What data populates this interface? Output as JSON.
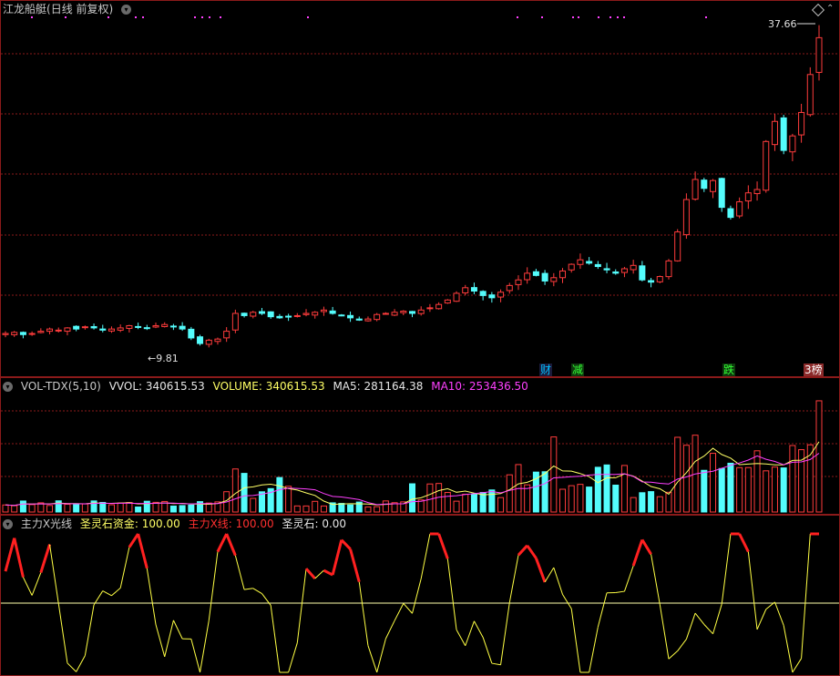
{
  "title": {
    "stock_name": "江龙船艇",
    "period": "(日线 前复权)",
    "menu_icon": "chevron-down-circle-icon"
  },
  "price": {
    "high_label": "37.66",
    "low_label": "9.81",
    "top_right_icon": "diamond-icon"
  },
  "event_tags": [
    {
      "text": "财",
      "color": "#00bfff",
      "bg": "#1a1a3a"
    },
    {
      "text": "减",
      "color": "#33ff33",
      "bg": "#0e3a0e"
    },
    {
      "text": "跌",
      "color": "#33ff33",
      "bg": "#0e3a0e"
    },
    {
      "text": "榜",
      "color": "#ffffff",
      "bg": "#8b2a2a",
      "prefix": "3"
    }
  ],
  "volume": {
    "name": "VOL-TDX(5,10)",
    "vvol": "VVOL: 340615.53",
    "volume": "VOLUME: 340615.53",
    "ma5": "MA5: 281164.38",
    "ma10": "MA10: 253436.50"
  },
  "indicator": {
    "name": "主力X光线",
    "fund": "圣灵石资金: 100.00",
    "xline": "主力X线: 100.00",
    "stone": "圣灵石: 0.00"
  },
  "colors": {
    "up": "#ff3c3c",
    "down": "#54fcfc",
    "ma5": "#ffff66",
    "ma10": "#ff40ff",
    "grid": "#8b1a1a",
    "ind_line": "#ffff44",
    "ind_strong": "#ff2020"
  },
  "chart_data": [
    {
      "type": "candlestick",
      "title": "江龙船艇(日线 前复权)",
      "annotations": [
        "37.66",
        "9.81"
      ],
      "approx_close": [
        10.8,
        10.9,
        10.7,
        10.8,
        11.0,
        11.2,
        11.1,
        11.3,
        11.2,
        11.4,
        11.3,
        11.1,
        11.2,
        11.3,
        11.5,
        11.4,
        11.3,
        11.5,
        11.6,
        11.4,
        11.2,
        10.4,
        9.9,
        10.2,
        10.3,
        11.0,
        12.6,
        12.4,
        12.7,
        12.6,
        12.3,
        12.2,
        12.3,
        12.4,
        12.6,
        12.7,
        12.9,
        12.6,
        12.4,
        12.2,
        12.0,
        12.1,
        12.5,
        12.6,
        12.7,
        12.8,
        12.6,
        12.9,
        13.1,
        13.4,
        13.8,
        14.4,
        14.9,
        14.6,
        14.2,
        14.0,
        14.5,
        15.1,
        15.6,
        16.2,
        16.0,
        15.5,
        15.8,
        16.4,
        17.0,
        17.4,
        17.1,
        16.8,
        16.5,
        16.2,
        16.6,
        16.9,
        15.6,
        15.4,
        15.9,
        17.3,
        19.9,
        22.8,
        24.6,
        23.8,
        24.5,
        22.1,
        21.2,
        22.6,
        23.4,
        23.7,
        28.0,
        29.8,
        27.2,
        28.5,
        30.6,
        34.0,
        37.3
      ]
    },
    {
      "type": "bar",
      "title": "VOL-TDX(5,10)",
      "series": [
        {
          "name": "VOLUME",
          "last": 340615.53
        },
        {
          "name": "MA5",
          "last": 281164.38
        },
        {
          "name": "MA10",
          "last": 253436.5
        }
      ]
    },
    {
      "type": "line",
      "title": "主力X光线",
      "ylim": [
        0,
        100
      ],
      "series": [
        {
          "name": "圣灵石资金",
          "last": 100.0
        },
        {
          "name": "主力X线",
          "last": 100.0
        },
        {
          "name": "圣灵石",
          "last": 0.0
        }
      ]
    }
  ]
}
